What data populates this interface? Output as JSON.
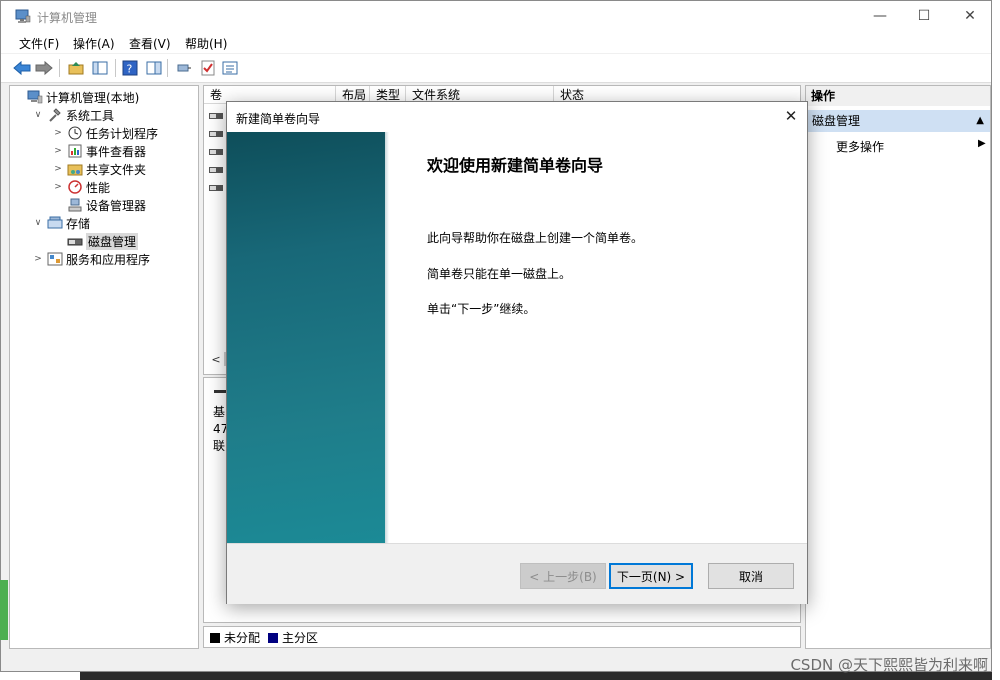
{
  "window": {
    "title": "计算机管理",
    "minimize": "—",
    "maximize": "☐",
    "close": "✕"
  },
  "menu": [
    "文件(F)",
    "操作(A)",
    "查看(V)",
    "帮助(H)"
  ],
  "tree": [
    {
      "label": "计算机管理(本地)",
      "indent": 0,
      "twisty": "",
      "icon": "computer-icon"
    },
    {
      "label": "系统工具",
      "indent": 1,
      "twisty": "∨",
      "icon": "tools-icon"
    },
    {
      "label": "任务计划程序",
      "indent": 2,
      "twisty": ">",
      "icon": "clock-icon"
    },
    {
      "label": "事件查看器",
      "indent": 2,
      "twisty": ">",
      "icon": "event-viewer-icon"
    },
    {
      "label": "共享文件夹",
      "indent": 2,
      "twisty": ">",
      "icon": "shared-folder-icon"
    },
    {
      "label": "性能",
      "indent": 2,
      "twisty": ">",
      "icon": "performance-icon"
    },
    {
      "label": "设备管理器",
      "indent": 2,
      "twisty": "",
      "icon": "device-manager-icon"
    },
    {
      "label": "存储",
      "indent": 1,
      "twisty": "∨",
      "icon": "storage-icon"
    },
    {
      "label": "磁盘管理",
      "indent": 2,
      "twisty": "",
      "icon": "disk-icon",
      "selected": true
    },
    {
      "label": "服务和应用程序",
      "indent": 1,
      "twisty": ">",
      "icon": "services-icon"
    }
  ],
  "columns": [
    "卷",
    "布局",
    "类型",
    "文件系统",
    "状态"
  ],
  "disk_info": [
    "基",
    "47",
    "联"
  ],
  "legend": [
    {
      "label": "未分配",
      "color": "#000000"
    },
    {
      "label": "主分区",
      "color": "#000080"
    }
  ],
  "actions": {
    "header": "操作",
    "section": "磁盘管理",
    "more": "更多操作"
  },
  "dialog": {
    "title": "新建简单卷向导",
    "heading": "欢迎使用新建简单卷向导",
    "line1": "此向导帮助你在磁盘上创建一个简单卷。",
    "line2": "简单卷只能在单一磁盘上。",
    "line3": "单击“下一步”继续。",
    "back": "< 上一步(B)",
    "next": "下一页(N) >",
    "cancel": "取消"
  },
  "watermark": "CSDN @天下熙熙皆为利来啊"
}
